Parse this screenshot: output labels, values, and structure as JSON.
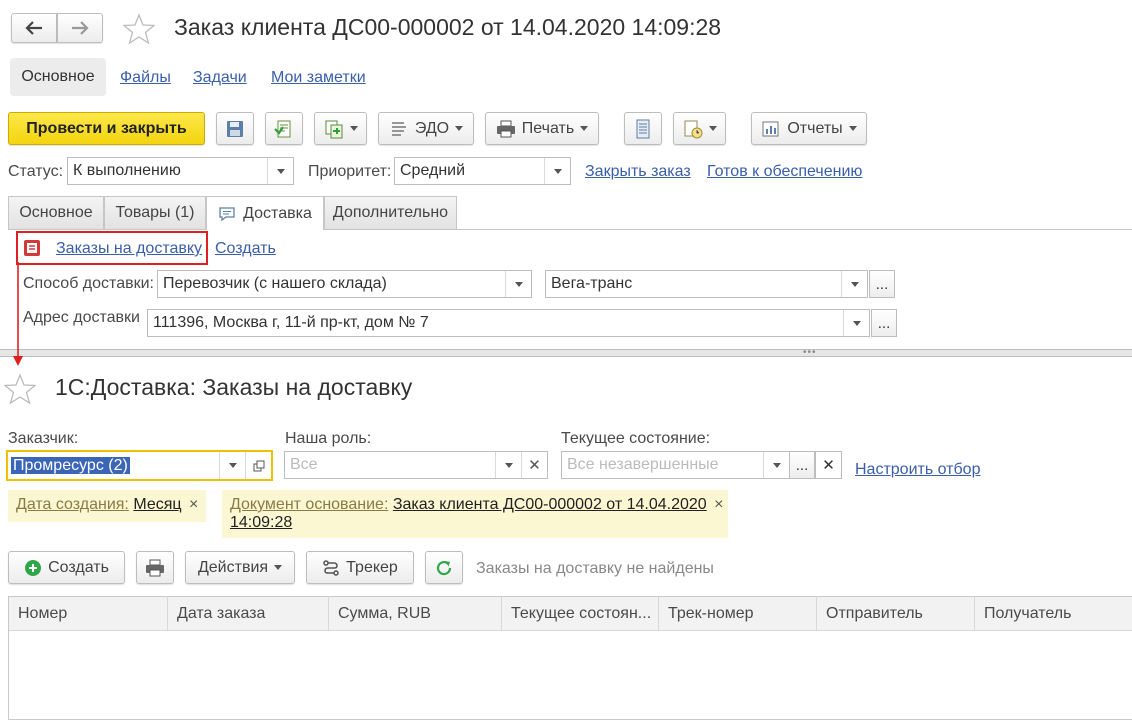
{
  "window": {
    "title": "Заказ клиента ДС00-000002 от 14.04.2020 14:09:28"
  },
  "nav_tabs": [
    {
      "label": "Основное"
    },
    {
      "label": "Файлы"
    },
    {
      "label": "Задачи"
    },
    {
      "label": "Мои заметки"
    }
  ],
  "toolbar": {
    "post_close_label": "Провести и закрыть",
    "edo_label": "ЭДО",
    "print_label": "Печать",
    "reports_label": "Отчеты"
  },
  "status_row": {
    "status_label": "Статус:",
    "status_value": "К выполнению",
    "priority_label": "Приоритет:",
    "priority_value": "Средний",
    "close_order_link": "Закрыть заказ",
    "ready_link": "Готов к обеспечению"
  },
  "doc_tabs": [
    {
      "label": "Основное"
    },
    {
      "label": "Товары (1)"
    },
    {
      "label": "Доставка",
      "active": true
    },
    {
      "label": "Дополнительно"
    }
  ],
  "delivery": {
    "orders_link": "Заказы на доставку",
    "create_link": "Создать",
    "method_label": "Способ доставки:",
    "method_value": "Перевозчик (с нашего склада)",
    "carrier_value": "Вега-транс",
    "address_label": "Адрес доставки",
    "address_value": "111396, Москва г, 11-й пр-кт, дом № 7",
    "more_label": "..."
  },
  "lower": {
    "title": "1С:Доставка: Заказы на доставку",
    "customer_label": "Заказчик:",
    "customer_value": "Промресурс (2)",
    "role_label": "Наша роль:",
    "role_placeholder": "Все",
    "state_label": "Текущее состояние:",
    "state_placeholder": "Все незавершенные",
    "setup_filter_link": "Настроить отбор",
    "filter_chips": [
      {
        "key": "Дата создания:",
        "value": "Месяц"
      },
      {
        "key": "Документ основание:",
        "value_line1": "Заказ клиента ДС00-000002 от 14.04.2020",
        "value_line2": "14:09:28"
      }
    ],
    "chip_close": "×",
    "create_label": "Создать",
    "actions_label": "Действия",
    "tracker_label": "Трекер",
    "empty_message": "Заказы на доставку не найдены",
    "columns": [
      "Номер",
      "Дата заказа",
      "Сумма, RUB",
      "Текущее состоян...",
      "Трек-номер",
      "Отправитель",
      "Получатель"
    ]
  },
  "colors": {
    "accent_yellow": "#f9dd1a",
    "link_blue": "#3a5ea8",
    "highlight_red": "#e02020",
    "chip_bg": "#fbf7d2",
    "focus_border": "#f0c000"
  }
}
